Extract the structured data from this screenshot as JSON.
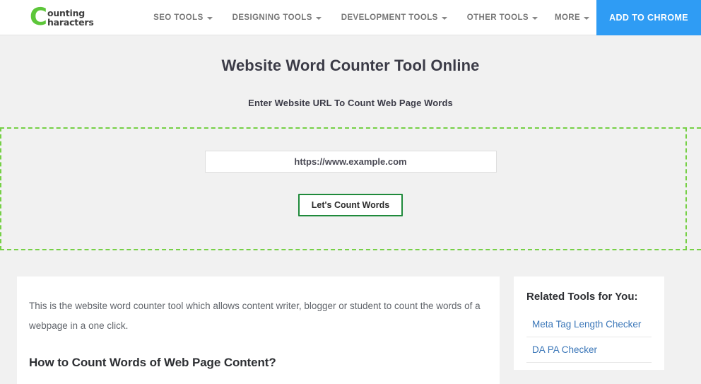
{
  "header": {
    "logo": {
      "initial": "C",
      "line1": "ounting",
      "line2": "haracters",
      "color": "#5dc63a"
    },
    "nav": [
      {
        "label": "SEO TOOLS",
        "has_caret": true
      },
      {
        "label": "DESIGNING TOOLS",
        "has_caret": true
      },
      {
        "label": "DEVELOPMENT TOOLS",
        "has_caret": true
      },
      {
        "label": "OTHER TOOLS",
        "has_caret": true
      },
      {
        "label": "MORE",
        "has_caret": true
      }
    ],
    "cta": {
      "label": "ADD TO CHROME",
      "color": "#2f9cf4"
    }
  },
  "hero": {
    "title": "Website Word Counter Tool Online",
    "subtitle": "Enter Website URL To Count Web Page Words"
  },
  "tool": {
    "url_field": {
      "value": "",
      "placeholder": "https://www.example.com"
    },
    "submit_label": "Let's Count Words",
    "border_color": "#76d046",
    "button_border_color": "#1f8a3b"
  },
  "article": {
    "intro": "This is the website word counter tool which allows content writer, blogger or student to count the words of a webpage in a one click.",
    "heading": "How to Count Words of Web Page Content?"
  },
  "sidebar": {
    "title": "Related Tools for You:",
    "links": [
      {
        "label": "Meta Tag Length Checker"
      },
      {
        "label": "DA PA Checker"
      }
    ],
    "link_color": "#3a76b8"
  }
}
